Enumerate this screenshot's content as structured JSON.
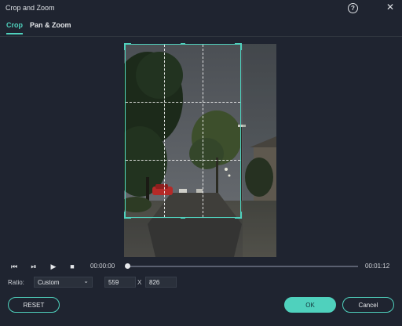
{
  "window": {
    "title": "Crop and Zoom",
    "help_icon": "help-icon",
    "close_icon": "close-icon"
  },
  "tabs": [
    {
      "label": "Crop",
      "active": true
    },
    {
      "label": "Pan & Zoom",
      "active": false
    }
  ],
  "playback": {
    "current_time": "00:00:00",
    "total_time": "00:01:12",
    "progress": 0,
    "controls": [
      "step-back-icon",
      "play-frame-icon",
      "play-icon",
      "stop-icon"
    ]
  },
  "ratio": {
    "label": "Ratio:",
    "selected": "Custom",
    "width": "559",
    "separator": "X",
    "height": "826"
  },
  "buttons": {
    "reset": "RESET",
    "ok": "OK",
    "cancel": "Cancel"
  },
  "colors": {
    "accent": "#4fd1bd",
    "background": "#1f2430"
  }
}
